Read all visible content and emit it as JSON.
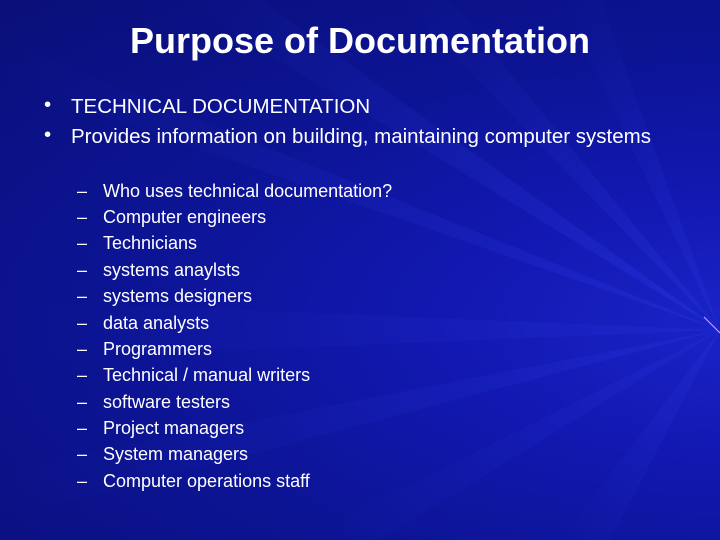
{
  "slide": {
    "title": "Purpose of Documentation",
    "background_color": "#0c1494",
    "text_color": "#ffffff",
    "bullets": [
      {
        "marker": "•",
        "text": "TECHNICAL DOCUMENTATION"
      },
      {
        "marker": "•",
        "text": "Provides information on building, maintaining computer systems"
      }
    ],
    "sub_bullets": [
      {
        "marker": "–",
        "text": "Who uses technical documentation?"
      },
      {
        "marker": "–",
        "text": "Computer engineers"
      },
      {
        "marker": "–",
        "text": "Technicians"
      },
      {
        "marker": "–",
        "text": "systems anaylsts"
      },
      {
        "marker": "–",
        "text": "systems designers"
      },
      {
        "marker": "–",
        "text": "data analysts"
      },
      {
        "marker": "–",
        "text": "Programmers"
      },
      {
        "marker": "–",
        "text": "Technical / manual writers"
      },
      {
        "marker": "–",
        "text": "software testers"
      },
      {
        "marker": "–",
        "text": "Project managers"
      },
      {
        "marker": "–",
        "text": "System managers"
      },
      {
        "marker": "–",
        "text": "Computer operations staff"
      }
    ]
  }
}
